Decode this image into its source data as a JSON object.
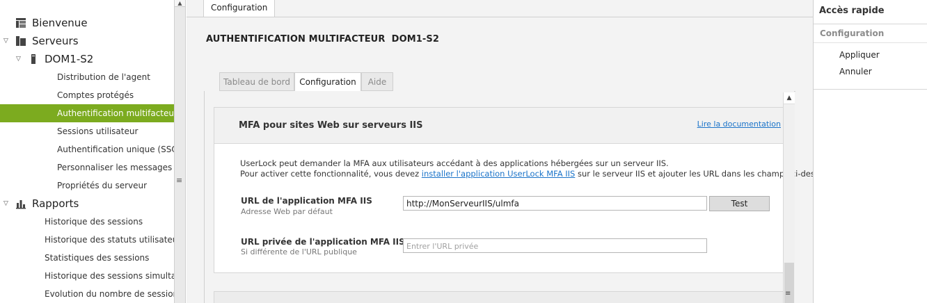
{
  "sidebar": {
    "items": [
      {
        "label": "Bienvenue",
        "level": 0,
        "icon": "grid-icon",
        "expanded": null,
        "active": false
      },
      {
        "label": "Serveurs",
        "level": 0,
        "icon": "servers-icon",
        "expanded": true,
        "active": false
      },
      {
        "label": "DOM1-S2",
        "level": 1,
        "icon": "server-icon",
        "expanded": true,
        "active": false
      },
      {
        "label": "Distribution de l'agent",
        "level": 2,
        "active": false
      },
      {
        "label": "Comptes protégés",
        "level": 2,
        "active": false
      },
      {
        "label": "Authentification multifacteur",
        "level": 2,
        "active": true
      },
      {
        "label": "Sessions utilisateur",
        "level": 2,
        "active": false
      },
      {
        "label": "Authentification unique (SSO)",
        "level": 2,
        "active": false
      },
      {
        "label": "Personnaliser les messages",
        "level": 2,
        "active": false
      },
      {
        "label": "Propriétés du serveur",
        "level": 2,
        "active": false
      },
      {
        "label": "Rapports",
        "level": 0,
        "icon": "bar-chart-icon",
        "expanded": true,
        "active": false
      },
      {
        "label": "Historique des sessions",
        "level": 3,
        "active": false
      },
      {
        "label": "Historique des statuts utilisateur",
        "level": 3,
        "active": false
      },
      {
        "label": "Statistiques des sessions",
        "level": 3,
        "active": false
      },
      {
        "label": "Historique des sessions simultan…",
        "level": 3,
        "active": false
      },
      {
        "label": "Evolution du nombre de sessions",
        "level": 3,
        "active": false
      }
    ]
  },
  "main": {
    "top_tab": "Configuration",
    "page_title": "AUTHENTIFICATION MULTIFACTEUR  DOM1-S2",
    "subtabs": [
      {
        "label": "Tableau de bord",
        "active": false
      },
      {
        "label": "Configuration",
        "active": true
      },
      {
        "label": "Aide",
        "active": false
      }
    ],
    "panel": {
      "title": "MFA pour sites Web sur serveurs IIS",
      "doc_link": "Lire la documentation",
      "desc_line1": "UserLock peut demander la MFA aux utilisateurs accédant à des applications hébergées sur un serveur IIS.",
      "desc_line2_before": "Pour activer cette fonctionnalité, vous devez ",
      "desc_line2_link": "installer l'application UserLock MFA IIS",
      "desc_line2_after": " sur le serveur IIS et ajouter les URL dans les champs ci-dessous.",
      "url_label": "URL de l'application MFA IIS",
      "url_sub": "Adresse Web par défaut",
      "url_value": "http://MonServeurIIS/ulmfa",
      "test_label": "Test",
      "private_label": "URL privée de l'application MFA IIS",
      "private_sub": "Si différente de l'URL publique",
      "private_value": "",
      "private_placeholder": "Entrer l'URL privée"
    }
  },
  "quick": {
    "title": "Accès rapide",
    "section": "Configuration",
    "items": [
      "Appliquer",
      "Annuler"
    ]
  },
  "colors": {
    "accent": "#7cab1f",
    "link": "#1a73c9"
  }
}
